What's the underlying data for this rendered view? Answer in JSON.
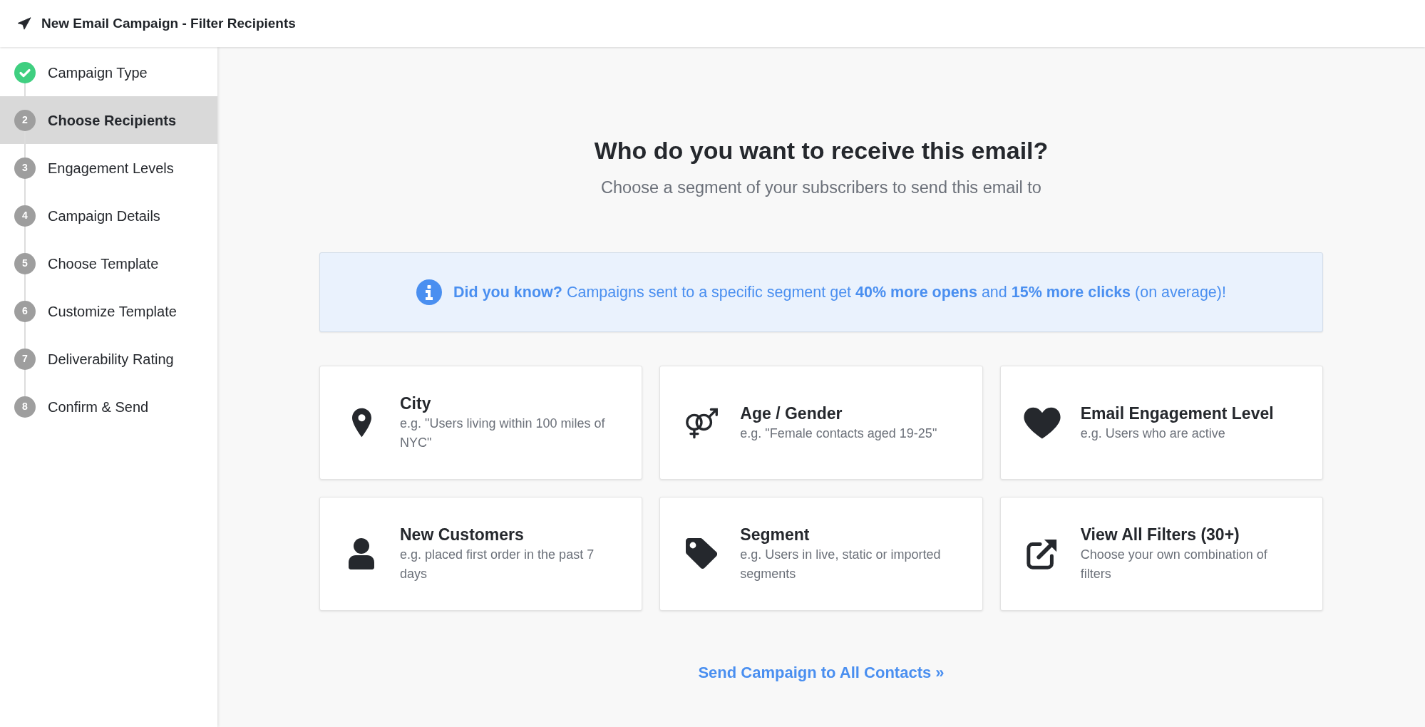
{
  "header": {
    "title": "New Email Campaign - Filter Recipients"
  },
  "steps": [
    {
      "label": "Campaign Type",
      "completed": true,
      "selected": false
    },
    {
      "number": "2",
      "label": "Choose Recipients",
      "completed": false,
      "selected": true
    },
    {
      "number": "3",
      "label": "Engagement Levels",
      "completed": false,
      "selected": false
    },
    {
      "number": "4",
      "label": "Campaign Details",
      "completed": false,
      "selected": false
    },
    {
      "number": "5",
      "label": "Choose Template",
      "completed": false,
      "selected": false
    },
    {
      "number": "6",
      "label": "Customize Template",
      "completed": false,
      "selected": false
    },
    {
      "number": "7",
      "label": "Deliverability Rating",
      "completed": false,
      "selected": false
    },
    {
      "number": "8",
      "label": "Confirm & Send",
      "completed": false,
      "selected": false
    }
  ],
  "prompt": {
    "heading": "Who do you want to receive this email?",
    "subheading": "Choose a segment of your subscribers to send this email to"
  },
  "tip": {
    "text": "**Did you know?** Campaigns sent to a specific segment get **40% more opens** and **15% more clicks** (on average)!"
  },
  "filters": [
    {
      "kind": "pin",
      "title": "City",
      "description": "e.g. \"Users living within 100 miles of NYC\""
    },
    {
      "kind": "gender",
      "title": "Age / Gender",
      "description": "e.g. \"Female contacts aged 19-25\""
    },
    {
      "kind": "heart",
      "title": "Email Engagement Level",
      "description": "e.g. Users who are active"
    },
    {
      "kind": "person",
      "title": "New Customers",
      "description": "e.g. placed first order in the past 7 days"
    },
    {
      "kind": "tag",
      "title": "Segment",
      "description": "e.g. Users in live, static or imported segments"
    },
    {
      "kind": "external",
      "title": "View All Filters (30+)",
      "description": "Choose your own combination of filters"
    }
  ],
  "footer_link": {
    "label": "Send Campaign to All Contacts »"
  }
}
